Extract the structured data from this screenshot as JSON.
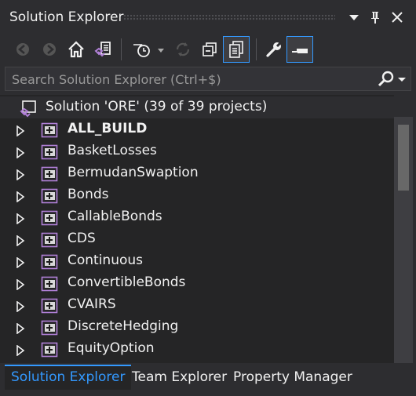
{
  "panel": {
    "title": "Solution Explorer"
  },
  "search": {
    "placeholder": "Search Solution Explorer (Ctrl+$)"
  },
  "solution": {
    "label": "Solution 'ORE' (39 of 39 projects)"
  },
  "projects": [
    {
      "name": "ALL_BUILD",
      "bold": true
    },
    {
      "name": "BasketLosses"
    },
    {
      "name": "BermudanSwaption"
    },
    {
      "name": "Bonds"
    },
    {
      "name": "CallableBonds"
    },
    {
      "name": "CDS"
    },
    {
      "name": "Continuous"
    },
    {
      "name": "ConvertibleBonds"
    },
    {
      "name": "CVAIRS"
    },
    {
      "name": "DiscreteHedging"
    },
    {
      "name": "EquityOption"
    }
  ],
  "tabs": [
    {
      "label": "Solution Explorer",
      "active": true
    },
    {
      "label": "Team Explorer"
    },
    {
      "label": "Property Manager"
    }
  ],
  "colors": {
    "background": "#2d2d30",
    "tree_background": "#252526",
    "accent": "#3399ff",
    "vs_purple": "#b180d7"
  },
  "icons": {
    "toolbar": [
      "back-icon",
      "forward-icon",
      "home-icon",
      "switch-views-icon",
      "pending-changes-filter-icon",
      "sync-icon",
      "collapse-all-icon",
      "show-all-files-icon",
      "properties-icon",
      "preview-selected-icon"
    ]
  }
}
